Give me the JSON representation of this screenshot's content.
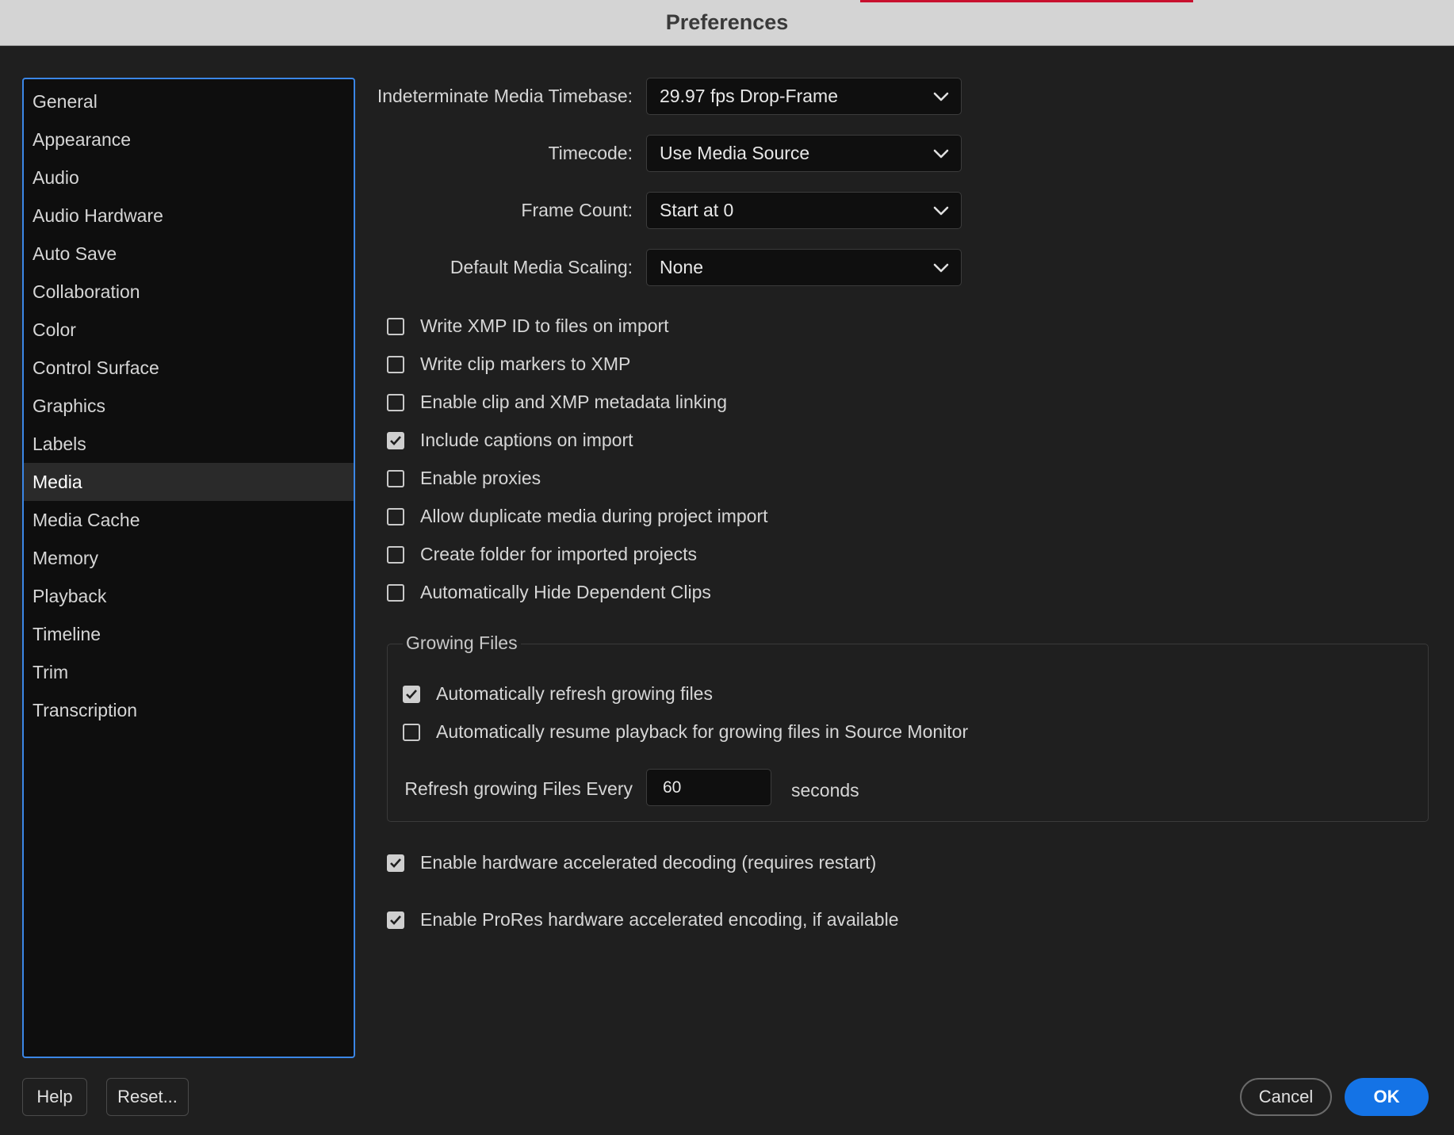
{
  "window": {
    "title": "Preferences",
    "accent_color": "#c8102e"
  },
  "sidebar": {
    "items": [
      {
        "label": "General"
      },
      {
        "label": "Appearance"
      },
      {
        "label": "Audio"
      },
      {
        "label": "Audio Hardware"
      },
      {
        "label": "Auto Save"
      },
      {
        "label": "Collaboration"
      },
      {
        "label": "Color"
      },
      {
        "label": "Control Surface"
      },
      {
        "label": "Graphics"
      },
      {
        "label": "Labels"
      },
      {
        "label": "Media",
        "selected": true
      },
      {
        "label": "Media Cache"
      },
      {
        "label": "Memory"
      },
      {
        "label": "Playback"
      },
      {
        "label": "Timeline"
      },
      {
        "label": "Trim"
      },
      {
        "label": "Transcription"
      }
    ]
  },
  "fields": {
    "timebase": {
      "label": "Indeterminate Media Timebase:",
      "value": "29.97 fps Drop-Frame"
    },
    "timecode": {
      "label": "Timecode:",
      "value": "Use Media Source"
    },
    "frame_count": {
      "label": "Frame Count:",
      "value": "Start at 0"
    },
    "scaling": {
      "label": "Default Media Scaling:",
      "value": "None"
    }
  },
  "checkboxes": [
    {
      "label": "Write XMP ID to files on import",
      "checked": false
    },
    {
      "label": "Write clip markers to XMP",
      "checked": false
    },
    {
      "label": "Enable clip and XMP metadata linking",
      "checked": false
    },
    {
      "label": "Include captions on import",
      "checked": true
    },
    {
      "label": "Enable proxies",
      "checked": false
    },
    {
      "label": "Allow duplicate media during project import",
      "checked": false
    },
    {
      "label": "Create folder for imported projects",
      "checked": false
    },
    {
      "label": "Automatically Hide Dependent Clips",
      "checked": false
    }
  ],
  "growing_files": {
    "legend": "Growing Files",
    "checkboxes": [
      {
        "label": "Automatically refresh growing files",
        "checked": true
      },
      {
        "label": "Automatically resume playback for growing files in Source Monitor",
        "checked": false
      }
    ],
    "refresh_label": "Refresh growing Files Every",
    "refresh_value": "60",
    "refresh_unit": "seconds"
  },
  "hardware": [
    {
      "label": "Enable hardware accelerated decoding (requires restart)",
      "checked": true
    },
    {
      "label": "Enable ProRes hardware accelerated encoding, if available",
      "checked": true
    }
  ],
  "buttons": {
    "help": "Help",
    "reset": "Reset...",
    "cancel": "Cancel",
    "ok": "OK",
    "ok_color": "#1473e6"
  }
}
